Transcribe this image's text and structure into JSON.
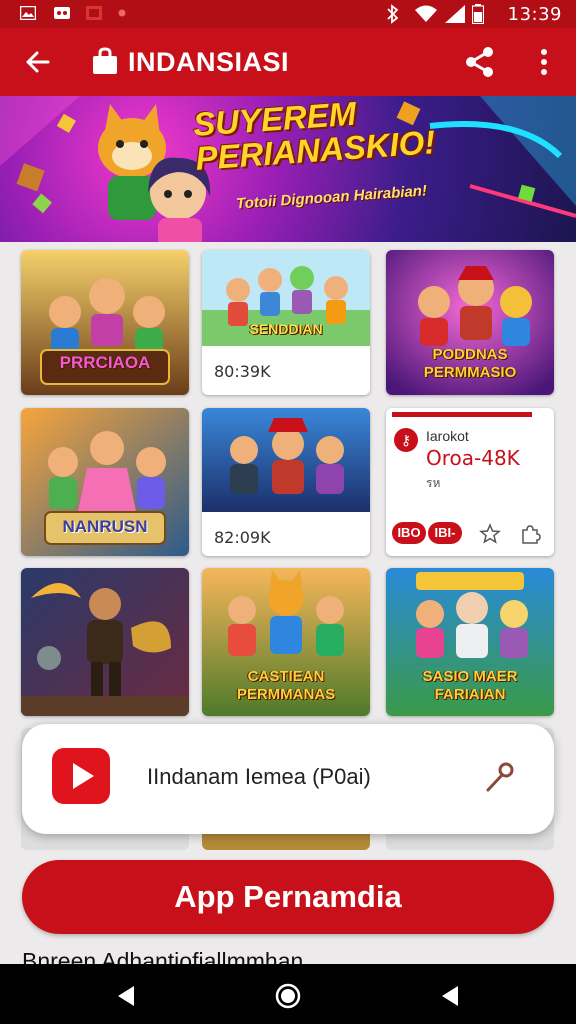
{
  "status_bar": {
    "time": "13:39",
    "icons": [
      "gallery-icon",
      "game-icon",
      "message-icon",
      "dot-icon",
      "bluetooth-icon",
      "wifi-icon",
      "signal-icon",
      "battery-icon"
    ]
  },
  "app_bar": {
    "title": "INDANSIASI",
    "icons": [
      "back-arrow-icon",
      "shopping-bag-icon",
      "share-icon",
      "more-vert-icon"
    ]
  },
  "banner": {
    "title_line1": "SUYEREM",
    "title_line2": "PERIANASKIO!",
    "subtitle": "Totoii Dignooan Hairabian!"
  },
  "cards": [
    {
      "title": "PRRCIAOA",
      "meta": ""
    },
    {
      "title": "SENDDIAN",
      "meta": "80:39K"
    },
    {
      "title": "PODDNAS PERMMASIO",
      "meta": ""
    },
    {
      "title": "NANRUSN",
      "meta": ""
    },
    {
      "title": "",
      "meta": "82:09K"
    },
    {
      "info_line1": "Iarokot",
      "info_line2": "Oroa-48K",
      "info_line3": "รห",
      "pill1": "IBO",
      "pill2": "IBI-"
    },
    {
      "title": "",
      "meta": ""
    },
    {
      "title": "CASTIEAN PERMMANAS",
      "meta": ""
    },
    {
      "title": "SASIO MAER FARIAIAN",
      "meta": ""
    }
  ],
  "popup": {
    "text": "IIndanam Iemea (P0ai)",
    "icons": [
      "youtube-icon",
      "pin-icon"
    ]
  },
  "cta": {
    "label": "App Pernamdia"
  },
  "footer": {
    "text": "Bnreen Adhantiofiallmmhan"
  },
  "colors": {
    "brand_red": "#c8101a",
    "status_red": "#b20e16",
    "background": "#eceaea"
  }
}
